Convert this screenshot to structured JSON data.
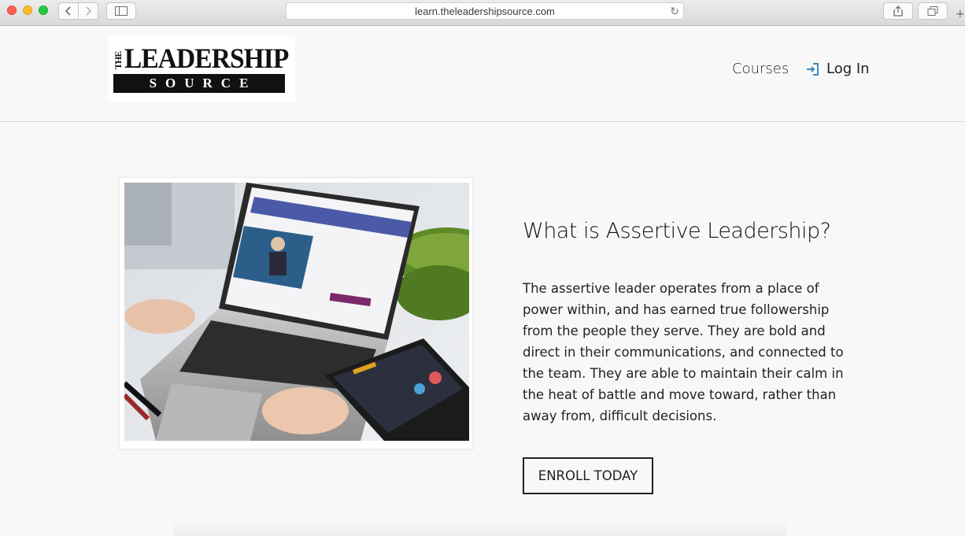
{
  "browser": {
    "url": "learn.theleadershipsource.com"
  },
  "header": {
    "logo": {
      "the": "THE",
      "main": "LEADERSHIP",
      "sub": "SOURCE"
    },
    "nav": {
      "courses": "Courses",
      "login": "Log In"
    }
  },
  "main": {
    "headline": "What is Assertive Leadership?",
    "description": "The assertive leader operates from a place of power within, and has earned true followership from the people they serve. They are bold and direct in their communications, and connected to the team. They are able to maintain their calm in the heat of battle and move toward, rather than away from, difficult decisions.",
    "enroll_label": "ENROLL TODAY"
  }
}
